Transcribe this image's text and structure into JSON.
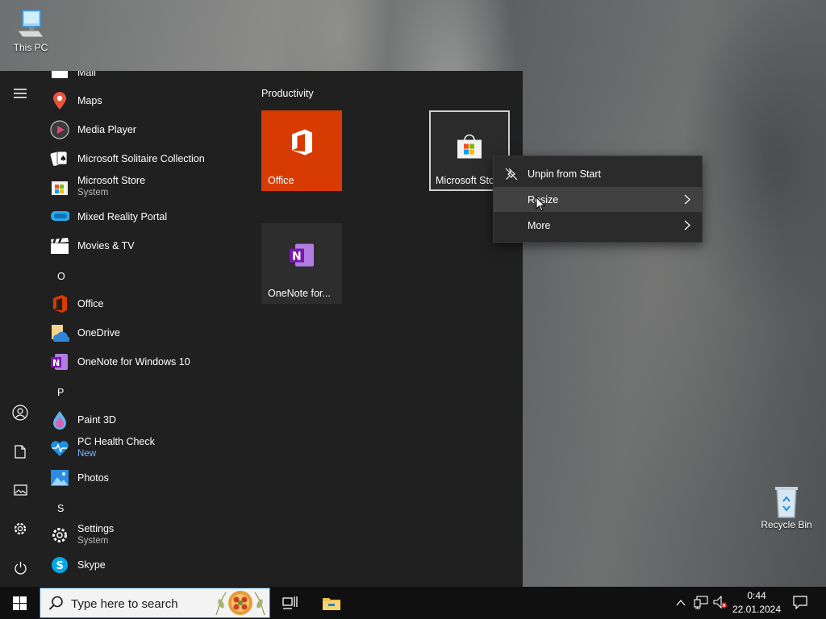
{
  "desktop": {
    "icons": [
      {
        "label": "This PC",
        "icon": "this-pc-icon"
      },
      {
        "label": "Recycle Bin",
        "icon": "recycle-bin-icon"
      }
    ]
  },
  "start_menu": {
    "apps": [
      {
        "label": "Mail",
        "icon": "mail-icon"
      },
      {
        "label": "Maps",
        "icon": "maps-icon"
      },
      {
        "label": "Media Player",
        "icon": "media-player-icon"
      },
      {
        "label": "Microsoft Solitaire Collection",
        "icon": "solitaire-icon"
      },
      {
        "label": "Microsoft Store",
        "sub": "System",
        "icon": "store-icon"
      },
      {
        "label": "Mixed Reality Portal",
        "icon": "mixed-reality-icon"
      },
      {
        "label": "Movies & TV",
        "icon": "movies-tv-icon"
      },
      {
        "label": "Office",
        "icon": "office-icon"
      },
      {
        "label": "OneDrive",
        "icon": "onedrive-icon"
      },
      {
        "label": "OneNote for Windows 10",
        "icon": "onenote-icon"
      },
      {
        "label": "Paint 3D",
        "icon": "paint3d-icon"
      },
      {
        "label": "PC Health Check",
        "sub": "New",
        "icon": "health-check-icon"
      },
      {
        "label": "Photos",
        "icon": "photos-icon"
      },
      {
        "label": "Settings",
        "sub": "System",
        "icon": "settings-icon"
      },
      {
        "label": "Skype",
        "icon": "skype-icon"
      }
    ],
    "letters": [
      "O",
      "P",
      "S"
    ],
    "group_title": "Productivity",
    "tiles": [
      {
        "label": "Office",
        "color": "#d83b01"
      },
      {
        "label": "Microsoft Sto",
        "color": "#2b2b2b"
      },
      {
        "label": "OneNote for...",
        "color": "#2d2d2d"
      }
    ]
  },
  "context_menu": {
    "items": [
      {
        "label": "Unpin from Start",
        "icon": "unpin-icon"
      },
      {
        "label": "Resize",
        "icon": "chevron-right-icon"
      },
      {
        "label": "More",
        "icon": "chevron-right-icon"
      }
    ]
  },
  "taskbar": {
    "search_placeholder": "Type here to search",
    "time": "0:44",
    "date": "22.01.2024"
  },
  "colors": {
    "accent": "#0078d4",
    "office": "#d83b01",
    "onenote": "#7719aa"
  }
}
